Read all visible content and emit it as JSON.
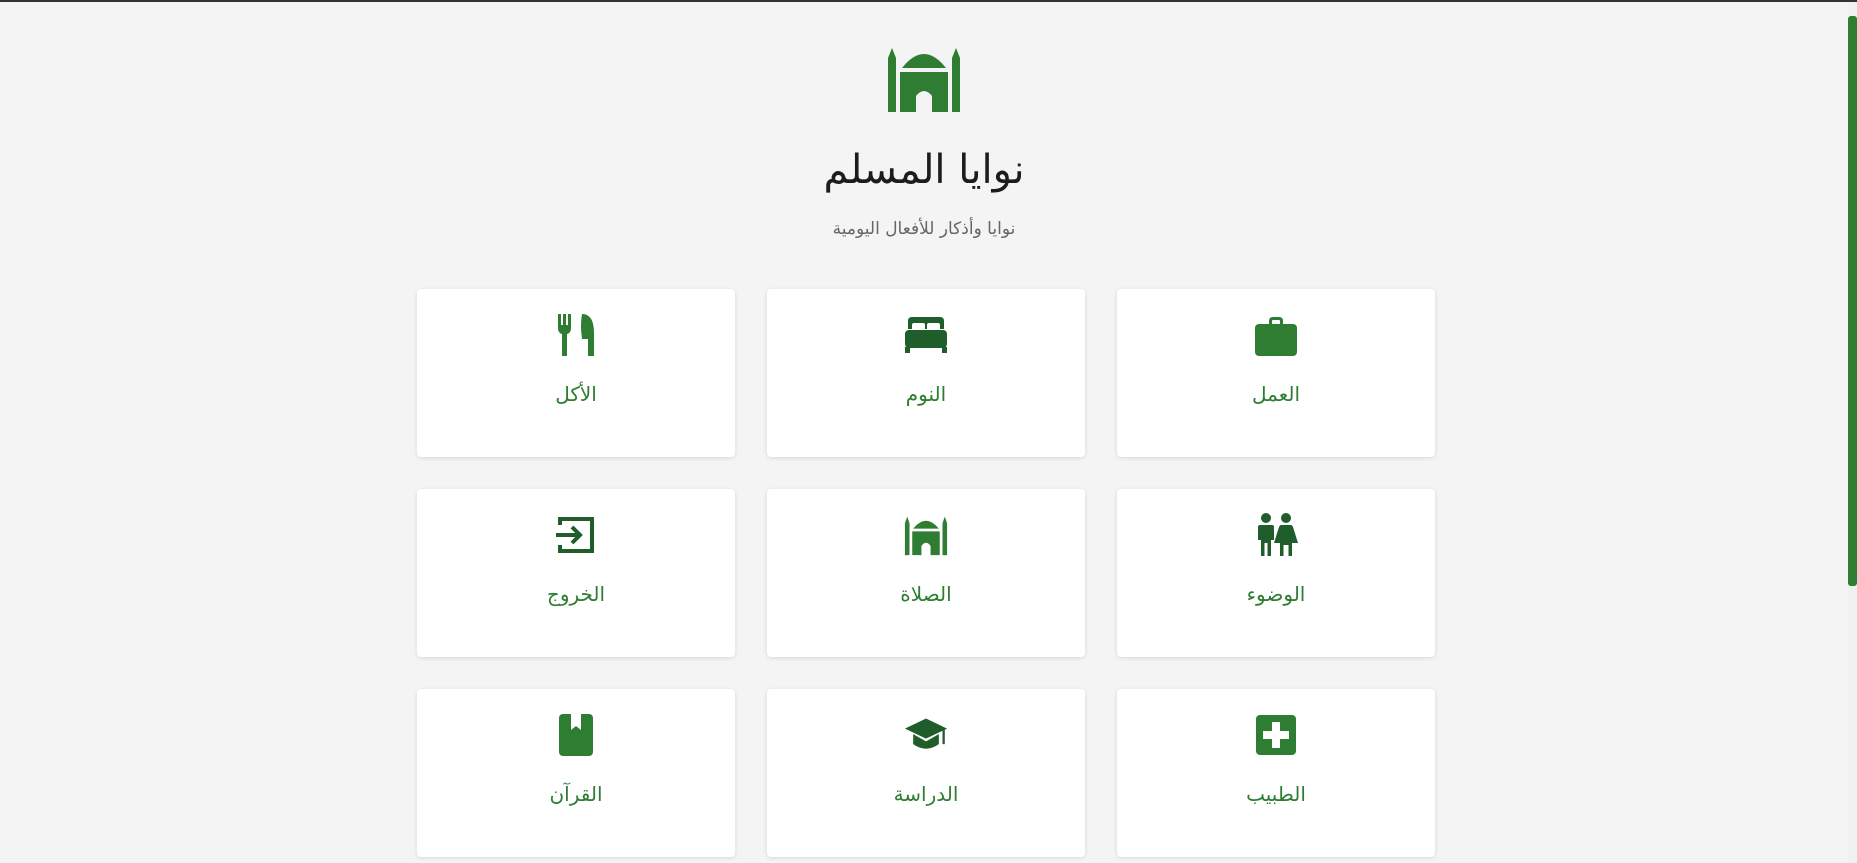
{
  "app": {
    "title": "نوايا المسلم",
    "subtitle": "نوايا وأذكار للأفعال اليومية",
    "logo_icon": "mosque-icon"
  },
  "colors": {
    "accent": "#2e7d32",
    "background": "#f4f4f4",
    "card": "#ffffff",
    "title": "#1c1c1c",
    "subtitle": "#666666"
  },
  "categories": [
    {
      "label": "العمل",
      "icon": "briefcase-icon"
    },
    {
      "label": "النوم",
      "icon": "bed-icon"
    },
    {
      "label": "الأكل",
      "icon": "utensils-icon"
    },
    {
      "label": "الوضوء",
      "icon": "restroom-icon"
    },
    {
      "label": "الصلاة",
      "icon": "mosque-icon"
    },
    {
      "label": "الخروج",
      "icon": "exit-icon"
    },
    {
      "label": "الطبيب",
      "icon": "medical-plus-icon"
    },
    {
      "label": "الدراسة",
      "icon": "graduation-cap-icon"
    },
    {
      "label": "القرآن",
      "icon": "quran-book-icon"
    }
  ]
}
